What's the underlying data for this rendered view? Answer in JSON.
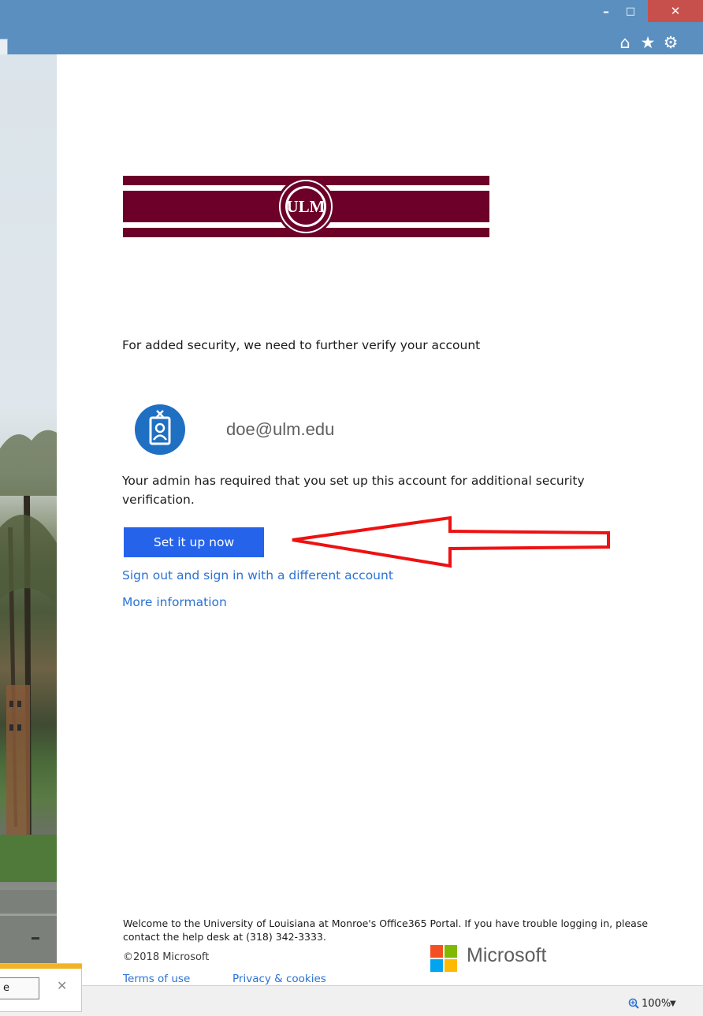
{
  "browser": {
    "window_controls": {
      "minimize": "–",
      "maximize": "□",
      "close": "✕"
    },
    "toolbar_icons": {
      "home": "⌂",
      "favorites": "★",
      "tools": "⚙"
    }
  },
  "content": {
    "logo_text": "ULM",
    "prompt": "For added security, we need to further verify your account",
    "user_email": "doe@ulm.edu",
    "admin_message": "Your admin has required that you set up this account for additional security verification.",
    "setup_button_label": "Set it up now",
    "signout_link": "Sign out and sign in with a different account",
    "more_info_link": "More information"
  },
  "footer": {
    "welcome": "Welcome to the University of Louisiana at Monroe's Office365 Portal. If you have trouble logging in, please contact the help desk at (318) 342-3333.",
    "copyright": "©2018 Microsoft",
    "brand": "Microsoft",
    "terms_link": "Terms of use",
    "privacy_link": "Privacy & cookies"
  },
  "statusbar": {
    "notification_button": "e",
    "notification_close": "✕",
    "zoom_level": "100%",
    "zoom_dropdown": "▼"
  },
  "colors": {
    "chrome_blue": "#5a8fc0",
    "close_red": "#c7504d",
    "brand_maroon": "#6c0028",
    "button_blue": "#2563eb",
    "link_blue": "#2a72d4",
    "avatar_blue": "#1f6fc2",
    "arrow_red": "#ee1111",
    "ms_red": "#f25022",
    "ms_green": "#7fba00",
    "ms_blue": "#00a4ef",
    "ms_yellow": "#ffb900"
  }
}
